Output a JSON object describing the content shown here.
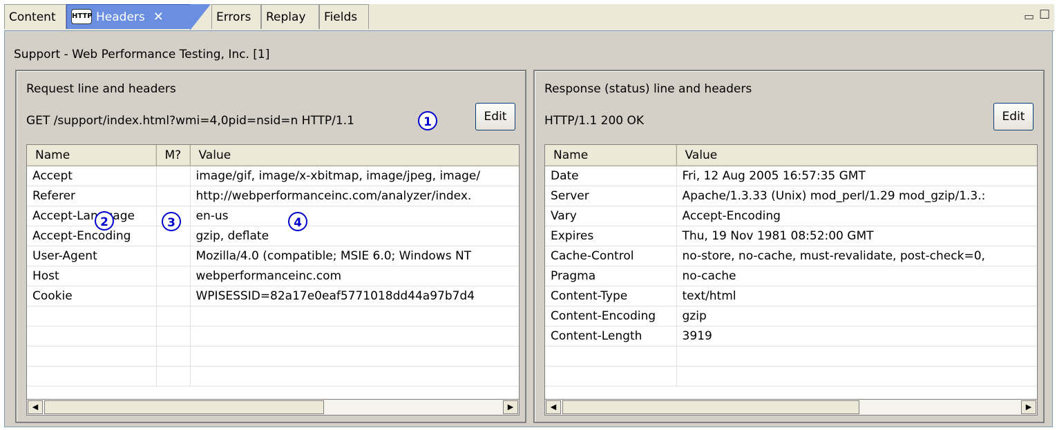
{
  "tabs": [
    {
      "label": "Content"
    },
    {
      "label": "Headers",
      "badge": "HTTP",
      "active": true
    },
    {
      "label": "Errors"
    },
    {
      "label": "Replay"
    },
    {
      "label": "Fields"
    }
  ],
  "breadcrumb": "Support - Web Performance Testing, Inc. [1]",
  "request": {
    "title": "Request line and headers",
    "line": "GET /support/index.html?wmi=4,0pid=nsid=n HTTP/1.1",
    "edit_label": "Edit",
    "columns": [
      "Name",
      "M?",
      "Value"
    ],
    "rows": [
      [
        "Accept",
        "",
        "image/gif, image/x-xbitmap, image/jpeg, image/"
      ],
      [
        "Referer",
        "",
        "http://webperformanceinc.com/analyzer/index."
      ],
      [
        "Accept-Language",
        "",
        "en-us"
      ],
      [
        "Accept-Encoding",
        "",
        "gzip, deflate"
      ],
      [
        "User-Agent",
        "",
        "Mozilla/4.0 (compatible; MSIE 6.0; Windows NT"
      ],
      [
        "Host",
        "",
        "webperformanceinc.com"
      ],
      [
        "Cookie",
        "",
        "WPISESSID=82a17e0eaf5771018dd44a97b7d4"
      ]
    ]
  },
  "response": {
    "title": "Response (status) line and headers",
    "line": "HTTP/1.1 200 OK",
    "edit_label": "Edit",
    "columns": [
      "Name",
      "Value"
    ],
    "rows": [
      [
        "Date",
        "Fri, 12 Aug 2005 16:57:35 GMT"
      ],
      [
        "Server",
        "Apache/1.3.33 (Unix) mod_perl/1.29 mod_gzip/1.3.:"
      ],
      [
        "Vary",
        "Accept-Encoding"
      ],
      [
        "Expires",
        "Thu, 19 Nov 1981 08:52:00 GMT"
      ],
      [
        "Cache-Control",
        "no-store, no-cache, must-revalidate, post-check=0,"
      ],
      [
        "Pragma",
        "no-cache"
      ],
      [
        "Content-Type",
        "text/html"
      ],
      [
        "Content-Encoding",
        "gzip"
      ],
      [
        "Content-Length",
        "3919"
      ]
    ]
  },
  "markers": [
    "1",
    "2",
    "3",
    "4"
  ],
  "icons": {
    "close": "close-icon",
    "minimize": "minimize-icon",
    "maximize": "maximize-icon",
    "scroll_left": "arrow-left-icon",
    "scroll_right": "arrow-right-icon"
  },
  "colors": {
    "active_tab": "#6a8ee0",
    "marker": "#0000cc",
    "pane": "#d4d0c8"
  }
}
